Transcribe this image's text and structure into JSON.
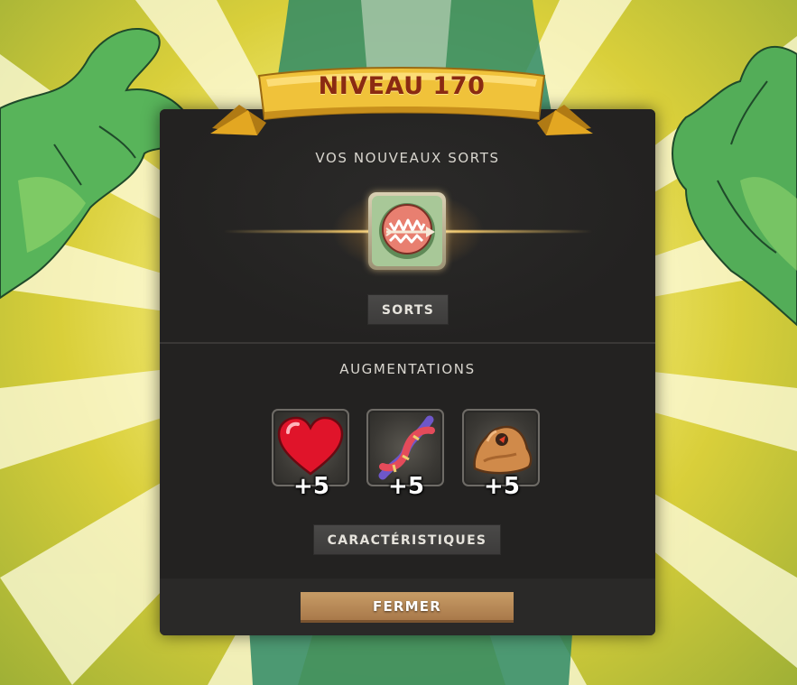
{
  "banner": {
    "level_label": "NIVEAU 170"
  },
  "spells": {
    "title": "VOS NOUVEAUX SORTS",
    "icon": "spell-fanged-arrow-icon",
    "button_label": "SORTS"
  },
  "augmentations": {
    "title": "AUGMENTATIONS",
    "items": [
      {
        "icon": "heart-icon",
        "value": "+5"
      },
      {
        "icon": "dna-icon",
        "value": "+5"
      },
      {
        "icon": "stone-icon",
        "value": "+5"
      }
    ],
    "button_label": "CARACTÉRISTIQUES"
  },
  "footer": {
    "close_label": "FERMER"
  },
  "colors": {
    "panel": "#232221",
    "banner_gold": "#e8b830",
    "banner_text": "#8a2a12",
    "close_button": "#b78552",
    "background": "#f6ec7a"
  }
}
